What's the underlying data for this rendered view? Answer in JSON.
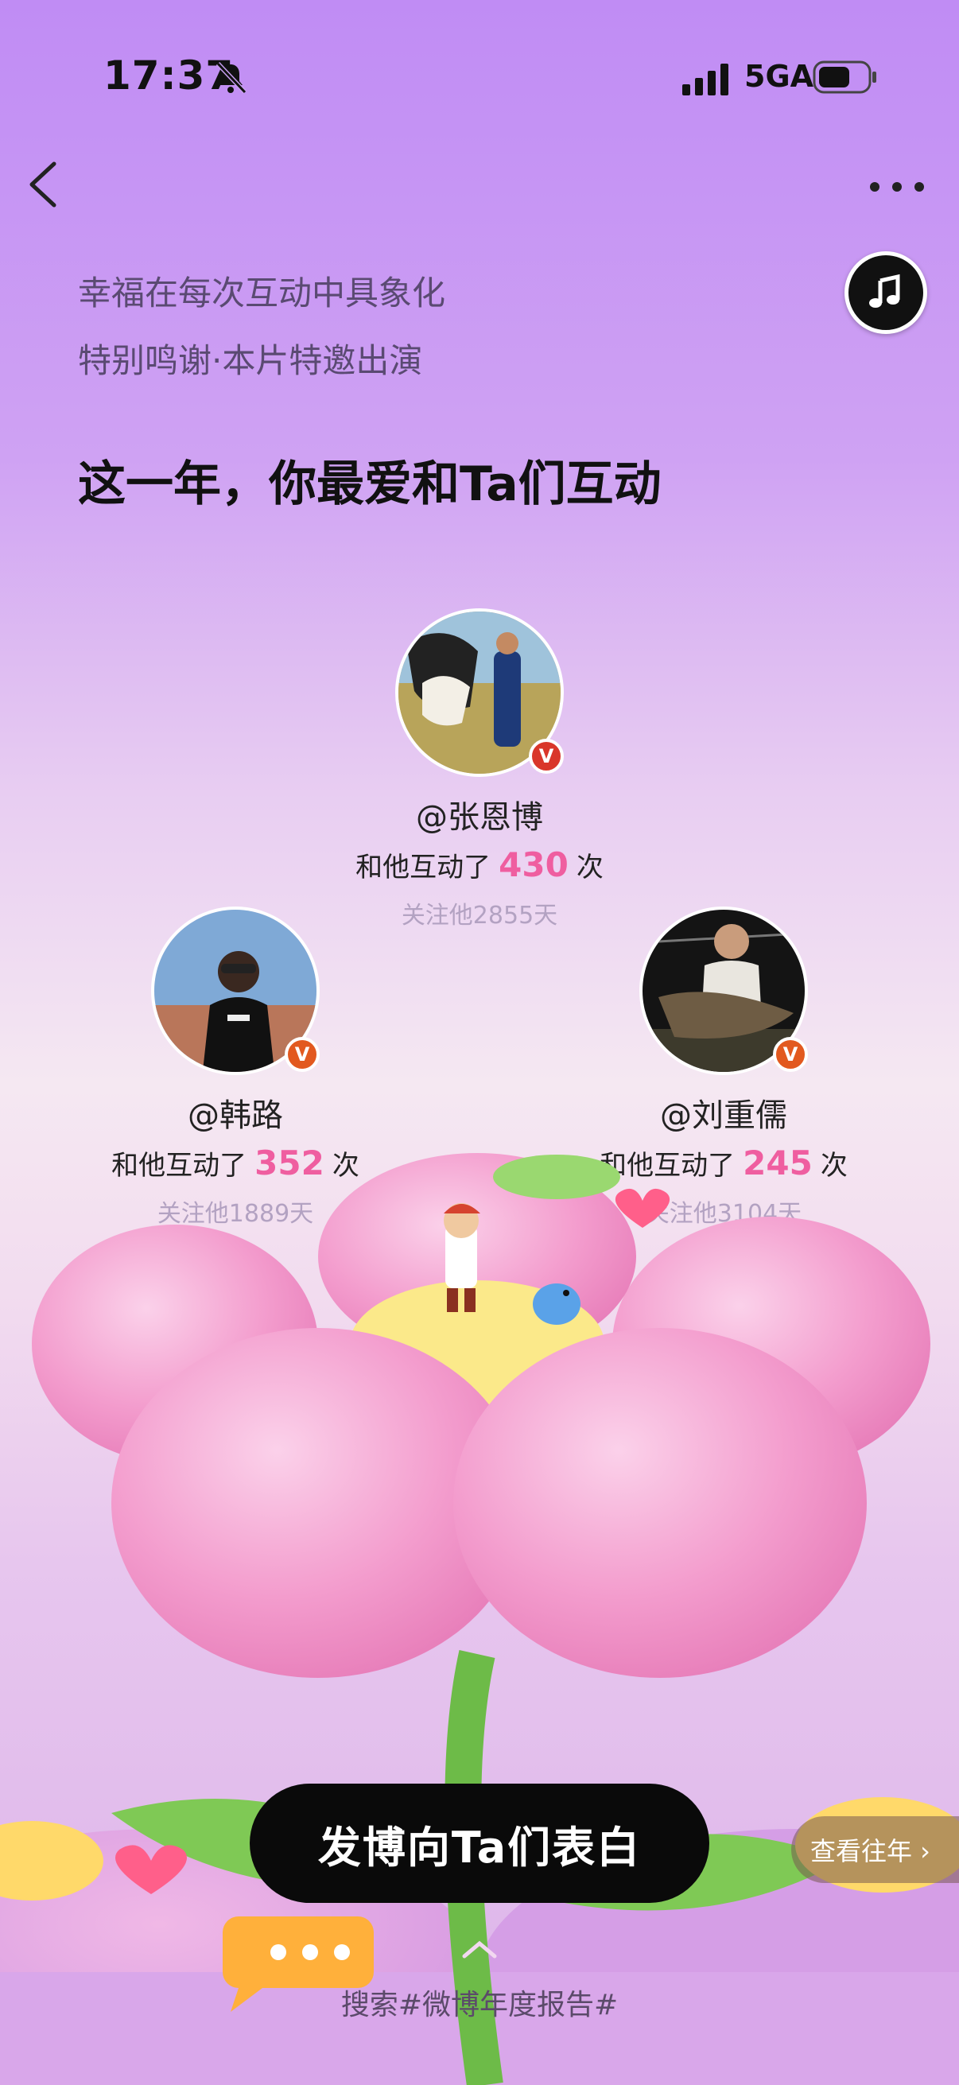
{
  "status": {
    "time": "17:37",
    "network": "5GA"
  },
  "header": {
    "subtitle1": "幸福在每次互动中具象化",
    "subtitle2": "特别鸣谢·本片特邀出演",
    "headline": "这一年，你最爱和Ta们互动"
  },
  "profiles": [
    {
      "handle": "@张恩博",
      "prefix": "和他互动了",
      "count": "430",
      "suffix": "次",
      "days": "关注他2855天"
    },
    {
      "handle": "@韩路",
      "prefix": "和他互动了",
      "count": "352",
      "suffix": "次",
      "days": "关注他1889天"
    },
    {
      "handle": "@刘重儒",
      "prefix": "和他互动了",
      "count": "245",
      "suffix": "次",
      "days": "关注他3104天"
    }
  ],
  "actions": {
    "cta": "发博向Ta们表白",
    "previous_years": "查看往年 ›",
    "search_hint": "搜索#微博年度报告#"
  },
  "colors": {
    "accent": "#ef5ea0",
    "cta_bg": "#0a0a0a"
  }
}
